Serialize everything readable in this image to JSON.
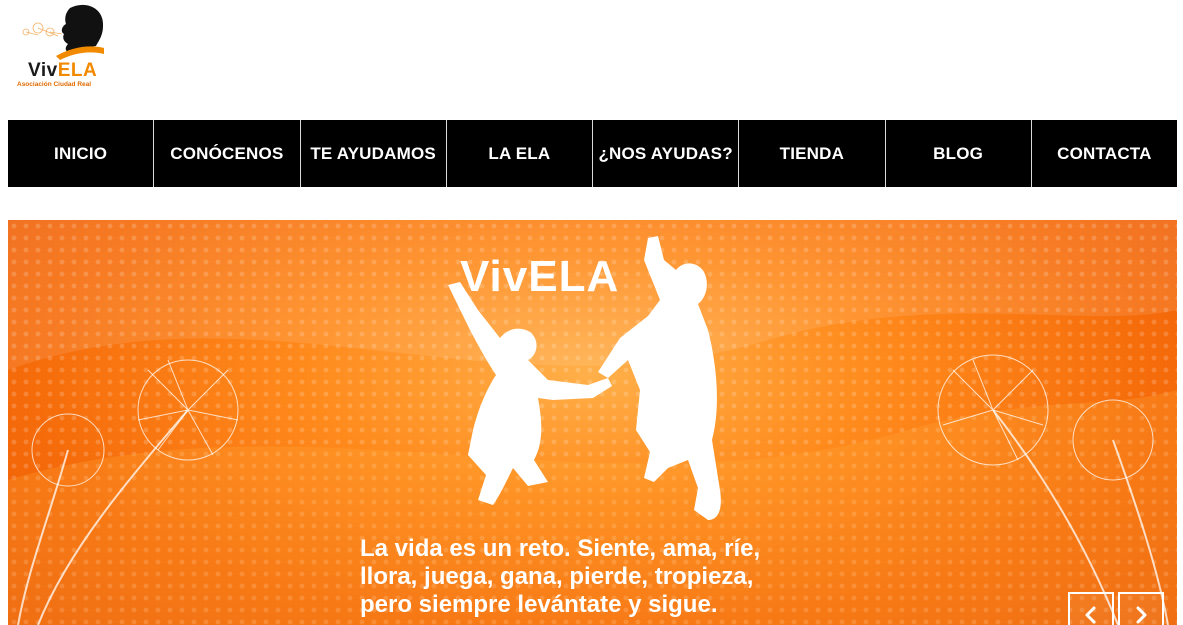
{
  "logo": {
    "name_dark": "Viv",
    "name_accent": "ELA",
    "subtitle": "Asociación Ciudad Real"
  },
  "nav": {
    "items": [
      {
        "label": "INICIO"
      },
      {
        "label": "CONÓCENOS"
      },
      {
        "label": "TE AYUDAMOS"
      },
      {
        "label": "LA ELA"
      },
      {
        "label": "¿NOS AYUDAS?"
      },
      {
        "label": "TIENDA"
      },
      {
        "label": "BLOG"
      },
      {
        "label": "CONTACTA"
      }
    ]
  },
  "slider": {
    "title": "VivELA",
    "caption_lines": [
      "La vida es un reto. Siente, ama, ríe,",
      "llora, juega, gana, pierde, tropieza,",
      "pero siempre levántate y sigue."
    ],
    "prev_icon": "chevron-left-icon",
    "next_icon": "chevron-right-icon"
  },
  "colors": {
    "nav_bg": "#000000",
    "slide_orange": "#f56a0a",
    "accent": "#f28a00"
  }
}
